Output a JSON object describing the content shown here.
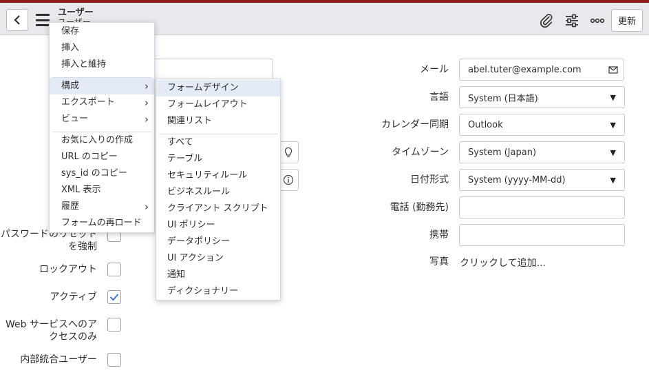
{
  "header": {
    "title": "ユーザー",
    "subtitle": "ユーザー",
    "update_label": "更新"
  },
  "form": {
    "email_label": "メール",
    "email_value": "abel.tuter@example.com",
    "language_label": "言語",
    "language_value": "System (日本語)",
    "calendar_label": "カレンダー同期",
    "calendar_value": "Outlook",
    "timezone_label": "タイムゾーン",
    "timezone_value": "System (Japan)",
    "dateformat_label": "日付形式",
    "dateformat_value": "System (yyyy-MM-dd)",
    "phone_label": "電話 (勤務先)",
    "phone_value": "",
    "mobile_label": "携帯",
    "mobile_value": "",
    "photo_label": "写真",
    "photo_link": "クリックして追加...",
    "password_reset_label_1": "パスワードのリセット",
    "password_reset_label_2": "を強制",
    "locked_out_label": "ロックアウト",
    "locked_out_checked": false,
    "active_label": "アクティブ",
    "active_checked": true,
    "web_service_label_1": "Web サービスへのア",
    "web_service_label_2": "クセスのみ",
    "web_service_checked": false,
    "internal_integration_label": "内部統合ユーザー",
    "internal_integration_checked": false
  },
  "context_menu": {
    "items": [
      {
        "label": "保存"
      },
      {
        "label": "挿入"
      },
      {
        "label": "挿入と維持"
      },
      {
        "label": "構成",
        "submenu": true,
        "highlighted": true
      },
      {
        "label": "エクスポート",
        "submenu": true
      },
      {
        "label": "ビュー",
        "submenu": true
      },
      {
        "label": "お気に入りの作成"
      },
      {
        "label": "URL のコピー"
      },
      {
        "label": "sys_id のコピー"
      },
      {
        "label": "XML 表示"
      },
      {
        "label": "履歴",
        "submenu": true
      },
      {
        "label": "フォームの再ロード"
      }
    ]
  },
  "configure_submenu": {
    "items": [
      {
        "label": "フォームデザイン",
        "highlighted": true
      },
      {
        "label": "フォームレイアウト"
      },
      {
        "label": "関連リスト"
      },
      {
        "label": "すべて"
      },
      {
        "label": "テーブル"
      },
      {
        "label": "セキュリティルール"
      },
      {
        "label": "ビジネスルール"
      },
      {
        "label": "クライアント スクリプト"
      },
      {
        "label": "UI ポリシー"
      },
      {
        "label": "データポリシー"
      },
      {
        "label": "UI アクション"
      },
      {
        "label": "通知"
      },
      {
        "label": "ディクショナリー"
      }
    ]
  },
  "colors": {
    "top_accent": "#8e1a1a",
    "header_bg": "#e7e9ec",
    "highlight": "#e4ebf6",
    "check": "#3a78c3"
  }
}
